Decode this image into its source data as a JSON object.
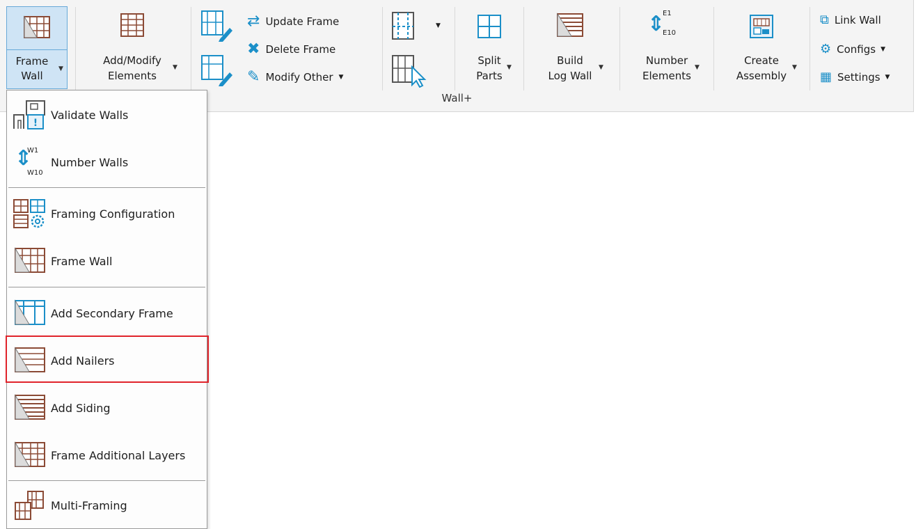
{
  "ribbon": {
    "group_label": "Wall+",
    "frame_wall": {
      "line1": "Frame",
      "line2": "Wall"
    },
    "add_modify": {
      "line1": "Add/Modify",
      "line2": "Elements"
    },
    "update_frame": "Update Frame",
    "delete_frame": "Delete Frame",
    "modify_other": "Modify Other",
    "split_parts": {
      "line1": "Split",
      "line2": "Parts"
    },
    "build_log_wall": {
      "line1": "Build",
      "line2": "Log Wall"
    },
    "number_elements": {
      "line1": "Number",
      "line2": "Elements",
      "tag_top": "E1",
      "tag_bottom": "E10"
    },
    "create_assembly": {
      "line1": "Create",
      "line2": "Assembly"
    },
    "link_wall": "Link Wall",
    "configs": "Configs",
    "settings": "Settings"
  },
  "menu": {
    "items": [
      {
        "label": "Validate Walls"
      },
      {
        "label": "Number Walls",
        "tag_top": "W1",
        "tag_bottom": "W10"
      },
      {
        "label": "Framing Configuration"
      },
      {
        "label": "Frame Wall"
      },
      {
        "label": "Add Secondary Frame"
      },
      {
        "label": "Add Nailers",
        "highlighted": true
      },
      {
        "label": "Add Siding"
      },
      {
        "label": "Frame Additional Layers"
      },
      {
        "label": "Multi-Framing"
      }
    ]
  },
  "colors": {
    "accent_blue": "#1b8fc8",
    "frame_brown": "#8b4a35",
    "highlight_red": "#e0232b",
    "selection_blue": "#cfe4f5"
  }
}
